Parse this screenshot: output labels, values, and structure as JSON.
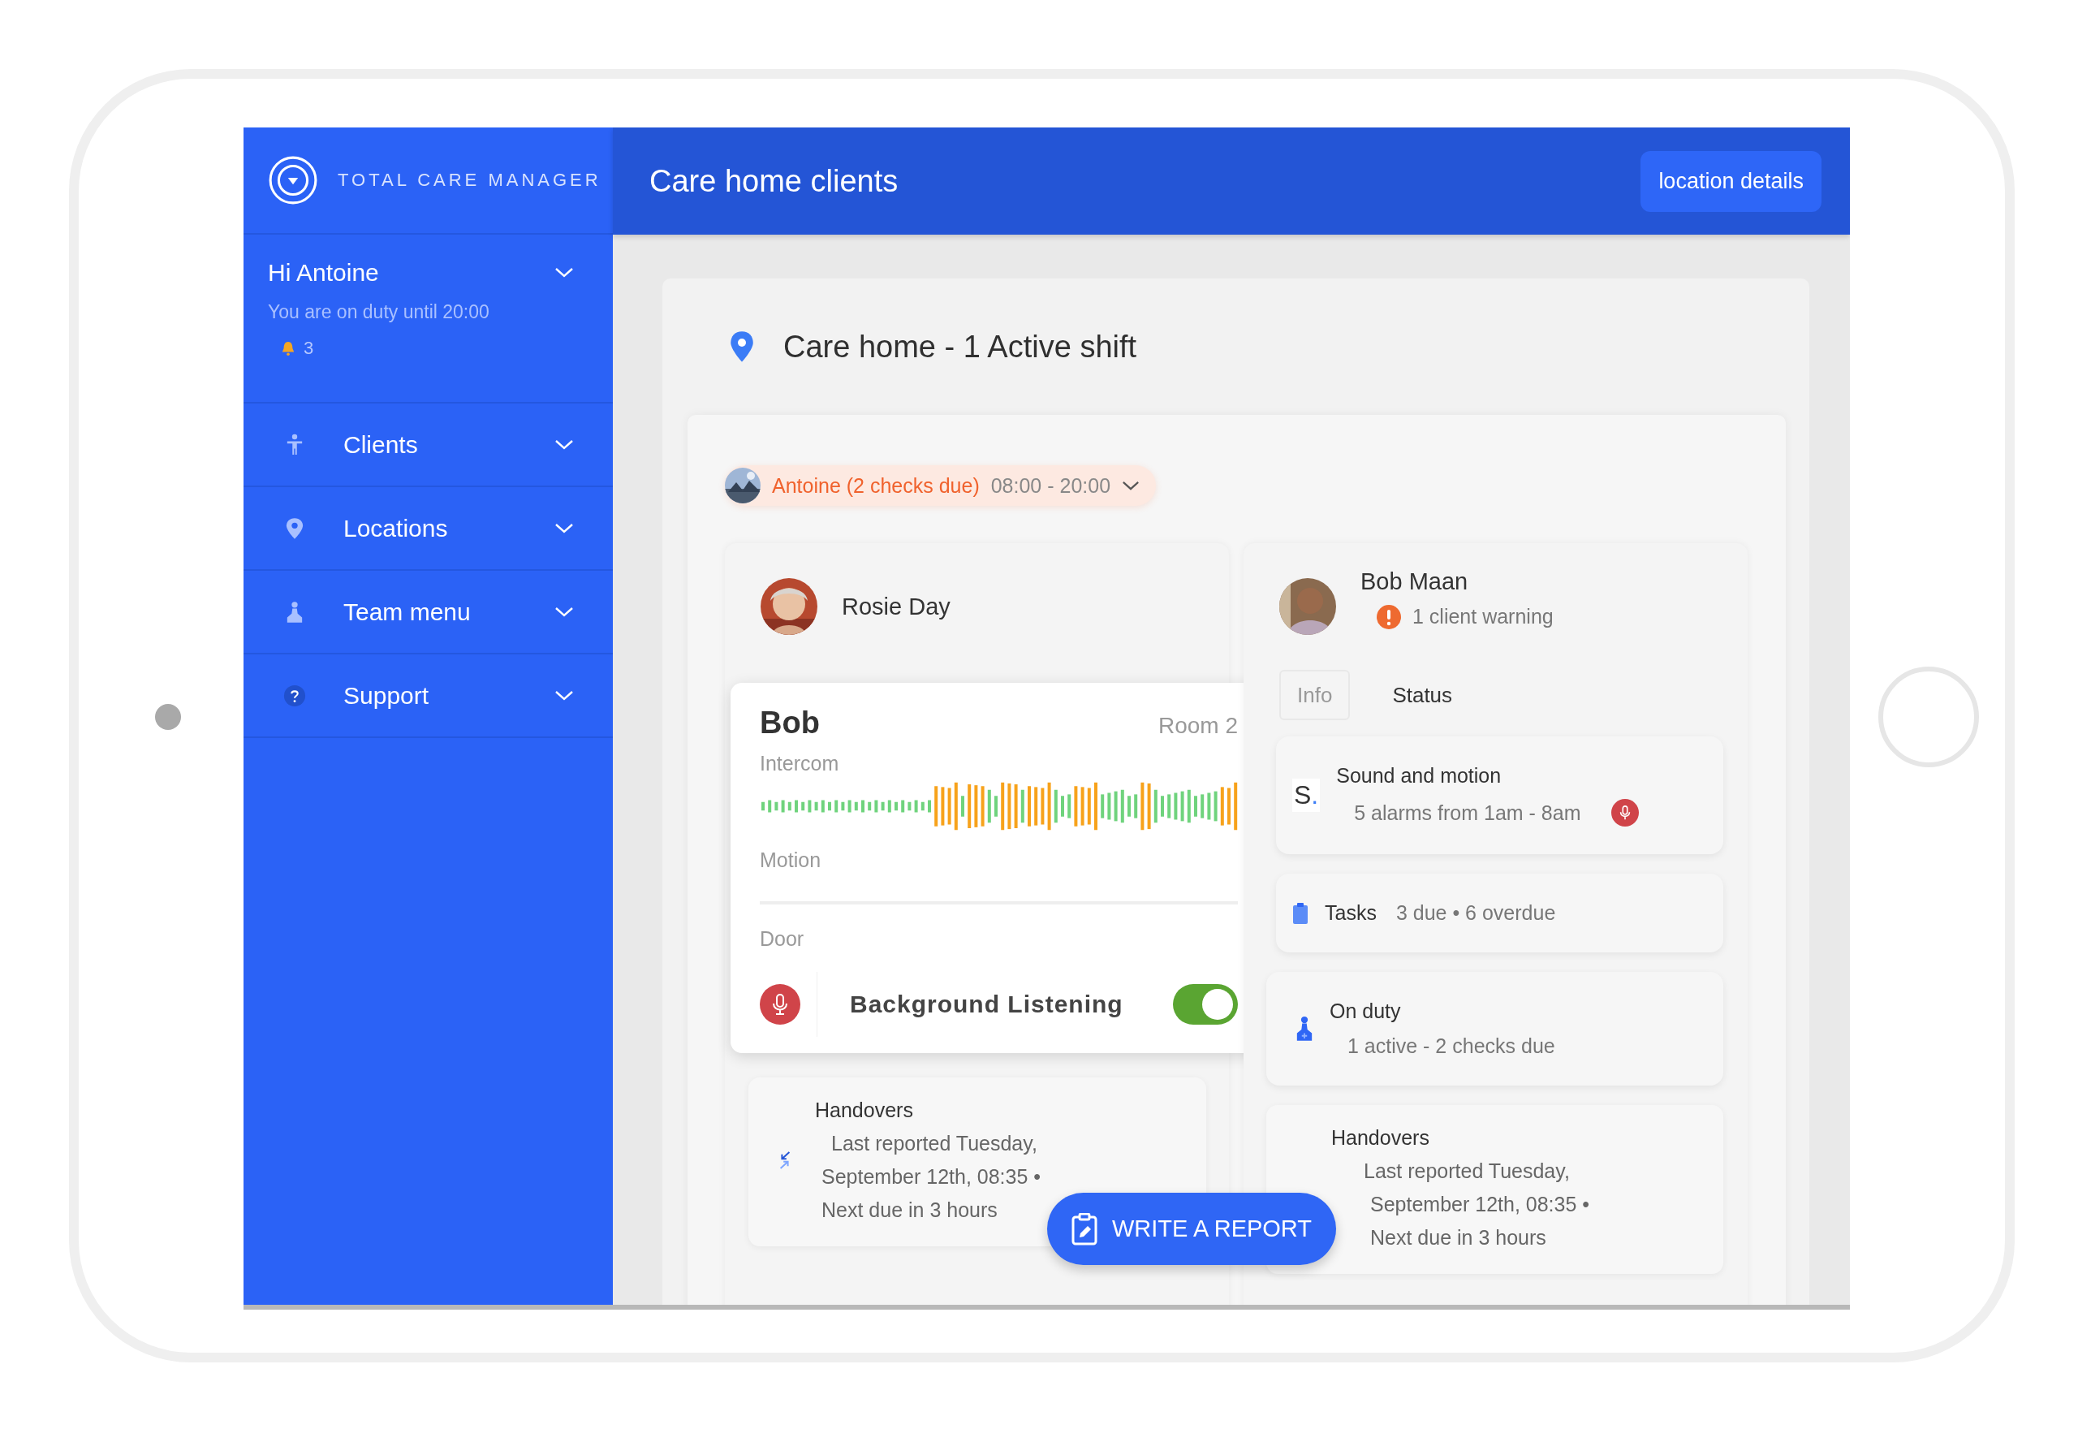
{
  "app": {
    "brand": "TOTAL CARE MANAGER"
  },
  "header": {
    "title": "Care home clients",
    "action": "location details"
  },
  "user": {
    "greeting": "Hi Antoine",
    "duty": "You are on duty until 20:00",
    "notifications": "3"
  },
  "nav": [
    {
      "label": "Clients"
    },
    {
      "label": "Locations"
    },
    {
      "label": "Team menu"
    },
    {
      "label": "Support"
    }
  ],
  "location": {
    "title": "Care home - 1 Active shift"
  },
  "shift": {
    "staff": "Antoine (2 checks due)",
    "hours": "08:00 - 20:00"
  },
  "clients": [
    {
      "name": "Rosie Day"
    },
    {
      "name": "Bob Maan",
      "warning": "1 client warning"
    }
  ],
  "monitor": {
    "name": "Bob",
    "room": "Room 2",
    "labels": [
      "Intercom",
      "Motion",
      "Door"
    ],
    "listening": {
      "label": "Background Listening",
      "on": true
    }
  },
  "tabs": [
    {
      "label": "Info",
      "selected": false
    },
    {
      "label": "Status",
      "selected": true
    }
  ],
  "status_cards": [
    {
      "kind": "sound",
      "badge": "S.",
      "title": "Sound and motion",
      "detail": "5 alarms from 1am - 8am"
    },
    {
      "kind": "tasks",
      "title": "Tasks",
      "detail": "3 due • 6 overdue"
    },
    {
      "kind": "duty",
      "title": "On duty",
      "detail": "1 active - 2 checks due"
    }
  ],
  "handovers": [
    {
      "title": "Handovers",
      "lines": [
        "Last reported Tuesday,",
        "September 12th, 08:35 •",
        "Next due in 3 hours"
      ],
      "has_icon": true
    },
    {
      "title": "Handovers",
      "lines": [
        "Last reported Tuesday,",
        "September 12th, 08:35 •",
        "Next due in 3 hours"
      ],
      "has_icon": false
    }
  ],
  "fab": {
    "label": "WRITE A REPORT"
  }
}
